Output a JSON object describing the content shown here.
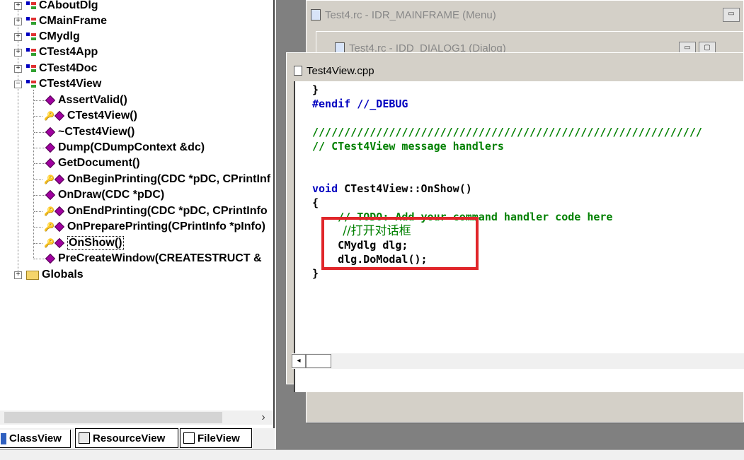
{
  "tree": {
    "classes": [
      {
        "label": "CAboutDlg",
        "expander": "+"
      },
      {
        "label": "CMainFrame",
        "expander": "+"
      },
      {
        "label": "CMydlg",
        "expander": "+"
      },
      {
        "label": "CTest4App",
        "expander": "+"
      },
      {
        "label": "CTest4Doc",
        "expander": "+"
      },
      {
        "label": "CTest4View",
        "expander": "−"
      }
    ],
    "members": [
      {
        "label": "AssertValid()",
        "icon": "public-method-icon"
      },
      {
        "label": "CTest4View()",
        "icon": "protected-method-icon"
      },
      {
        "label": "~CTest4View()",
        "icon": "public-method-icon"
      },
      {
        "label": "Dump(CDumpContext &dc)",
        "icon": "public-method-icon"
      },
      {
        "label": "GetDocument()",
        "icon": "public-method-icon"
      },
      {
        "label": "OnBeginPrinting(CDC *pDC, CPrintInf",
        "icon": "protected-method-icon"
      },
      {
        "label": "OnDraw(CDC *pDC)",
        "icon": "public-method-icon"
      },
      {
        "label": "OnEndPrinting(CDC *pDC, CPrintInfo",
        "icon": "protected-method-icon"
      },
      {
        "label": "OnPreparePrinting(CPrintInfo *pInfo)",
        "icon": "protected-method-icon"
      },
      {
        "label": "OnShow()",
        "icon": "protected-method-icon",
        "selected": true
      },
      {
        "label": "PreCreateWindow(CREATESTRUCT &",
        "icon": "public-method-icon"
      }
    ],
    "globals": {
      "label": "Globals",
      "expander": "+"
    },
    "scroll_right": "›"
  },
  "tabs": [
    "ClassView",
    "ResourceView",
    "FileView"
  ],
  "windows": {
    "menu_title": "Test4.rc - IDR_MAINFRAME (Menu)",
    "dialog_title": "Test4.rc - IDD_DIALOG1 (Dialog)",
    "editor_title": "Test4View.cpp"
  },
  "code": [
    {
      "text": "}",
      "cls": "tx"
    },
    {
      "text": "#endif //_DEBUG",
      "cls": "kw"
    },
    {
      "text": "",
      "cls": "tx"
    },
    {
      "text": "/////////////////////////////////////////////////////////////",
      "cls": "cm"
    },
    {
      "text": "// CTest4View message handlers",
      "cls": "cm"
    },
    {
      "text": "",
      "cls": "tx"
    },
    {
      "text": "",
      "cls": "tx"
    },
    {
      "text": "void CTest4View::OnShow()",
      "cls": "mix"
    },
    {
      "text": "{",
      "cls": "tx"
    },
    {
      "text": "    // TODO: Add your command handler code here",
      "cls": "cm"
    },
    {
      "text": "        //打开对话框",
      "cls": "cm"
    },
    {
      "text": "    CMydlg dlg;",
      "cls": "tx"
    },
    {
      "text": "    dlg.DoModal();",
      "cls": "tx"
    },
    {
      "text": "}",
      "cls": "tx"
    }
  ],
  "colors": {
    "highlight": "#e0262a",
    "keyword": "#0000c0",
    "comment": "#008000"
  }
}
